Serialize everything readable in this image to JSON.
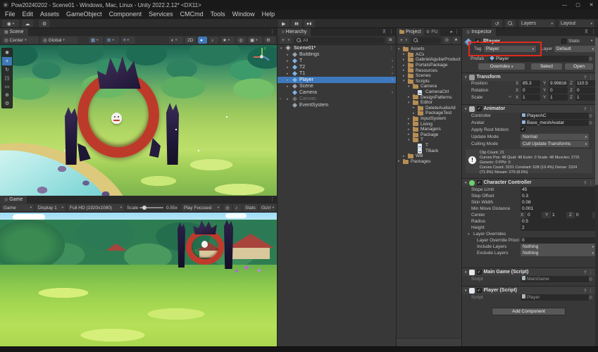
{
  "titlebar": {
    "title": "Pow20240202 - Scene01 - Windows, Mac, Linux - Unity 2022.2.12* <DX11>",
    "minimize": "—",
    "maximize": "▢",
    "close": "✕"
  },
  "menubar": {
    "items": [
      "File",
      "Edit",
      "Assets",
      "GameObject",
      "Component",
      "Services",
      "CMCmd",
      "Tools",
      "Window",
      "Help"
    ]
  },
  "toolbar": {
    "layers": "Layers",
    "layout": "Layout"
  },
  "icons": {
    "dropdown": "▾",
    "menu_dots": "⋮",
    "collapse_open": "▾",
    "collapse_closed": "▸",
    "prefab_arrow": "›",
    "check": "✓",
    "play": "▶",
    "pause": "▮▮",
    "step": "▶▮",
    "account": "◉",
    "cloud": "☁",
    "gear": "⚙",
    "history": "↺",
    "shading": "◐",
    "bulb": "●",
    "audio": "♪",
    "fx": "★",
    "eye": "◎",
    "camera": "▣",
    "grid": "▦",
    "snap": "⊞",
    "increment": "≡",
    "capture": "◎",
    "picker": "◎",
    "help": "?",
    "presets": "☰",
    "link": "∞",
    "warn": "!",
    "overflow": "▸",
    "pin": "⊼",
    "tools": [
      "✱",
      "+",
      "↻",
      "◳",
      "▭",
      "⊕",
      "⚙"
    ]
  },
  "scene_view": {
    "tab": "Scene",
    "pivot": "Center",
    "orientation": "Global",
    "two_d": "2D"
  },
  "game_view": {
    "tab": "Game",
    "mode": "Game",
    "display": "Display 1",
    "resolution": "Full HD (1920x1080)",
    "scale_label": "Scale",
    "scale_value": "0.55x",
    "focus_mode": "Play Focused",
    "stats_label": "Stats",
    "gizmos_label": "Gizmos"
  },
  "hierarchy": {
    "tab": "Hierarchy",
    "create_button": "+",
    "search_text": "All",
    "scene_row": {
      "name": "Scene01*"
    },
    "items": [
      {
        "name": "Buildings",
        "icon": "gameobject",
        "children": true
      },
      {
        "name": "T",
        "icon": "prefab",
        "children": true,
        "prefab_arrow": true
      },
      {
        "name": "T2",
        "icon": "prefab",
        "children": true,
        "prefab_arrow": true
      },
      {
        "name": "T1",
        "icon": "prefab",
        "children": true,
        "prefab_arrow": true
      },
      {
        "name": "Player",
        "icon": "prefab",
        "children": true,
        "prefab_arrow": true,
        "selected": true
      },
      {
        "name": "Scene",
        "icon": "gameobject",
        "children": true
      },
      {
        "name": "Camera",
        "icon": "prefab",
        "prefab_arrow": true
      },
      {
        "name": "Canvas",
        "icon": "gameobject",
        "children": true,
        "dim": true
      },
      {
        "name": "EventSystem",
        "icon": "gameobject"
      }
    ]
  },
  "project": {
    "tab": "Project",
    "tab2": "Piz",
    "create_button": "+",
    "tree": [
      {
        "name": "Assets",
        "depth": 0,
        "type": "folder",
        "state": "open"
      },
      {
        "name": "ACs",
        "depth": 1,
        "type": "folder",
        "state": "closed"
      },
      {
        "name": "GabrielAguilarProductio",
        "depth": 1,
        "type": "folder",
        "state": "closed"
      },
      {
        "name": "PortalsPackage",
        "depth": 1,
        "type": "folder",
        "state": "closed"
      },
      {
        "name": "Resources",
        "depth": 1,
        "type": "folder",
        "state": "closed"
      },
      {
        "name": "Scenes",
        "depth": 1,
        "type": "folder",
        "state": "closed"
      },
      {
        "name": "Scripts",
        "depth": 1,
        "type": "folder",
        "state": "open"
      },
      {
        "name": "Camera",
        "depth": 2,
        "type": "folder",
        "state": "open"
      },
      {
        "name": "CameraCtrl",
        "depth": 3,
        "type": "script"
      },
      {
        "name": "DesignPatterns",
        "depth": 2,
        "type": "folder",
        "state": "closed"
      },
      {
        "name": "Editor",
        "depth": 2,
        "type": "folder",
        "state": "open"
      },
      {
        "name": "DeleteAudioAll",
        "depth": 3,
        "type": "folder",
        "state": "closed"
      },
      {
        "name": "PackageTest",
        "depth": 3,
        "type": "folder",
        "state": "closed"
      },
      {
        "name": "InputSystem",
        "depth": 2,
        "type": "folder",
        "state": "closed"
      },
      {
        "name": "Living",
        "depth": 2,
        "type": "folder",
        "state": "closed"
      },
      {
        "name": "Managers",
        "depth": 2,
        "type": "folder",
        "state": "closed"
      },
      {
        "name": "Package",
        "depth": 2,
        "type": "folder",
        "state": "closed"
      },
      {
        "name": "T",
        "depth": 2,
        "type": "folder",
        "state": "open"
      },
      {
        "name": "T",
        "depth": 3,
        "type": "script"
      },
      {
        "name": "TBack",
        "depth": 3,
        "type": "script"
      },
      {
        "name": "WB",
        "depth": 1,
        "type": "folder",
        "state": "closed"
      },
      {
        "name": "Packages",
        "depth": 0,
        "type": "folder",
        "state": "closed"
      }
    ]
  },
  "axes": [
    "X",
    "Y",
    "Z"
  ],
  "inspector": {
    "tab": "Inspector",
    "header": {
      "name": "Player",
      "static_label": "Static"
    },
    "tag_layer": {
      "tag_label": "Tag",
      "tag": "Player",
      "layer_label": "Layer",
      "layer": "Default"
    },
    "prefab": {
      "label": "Prefab",
      "name": "Player",
      "overrides": "Overrides",
      "select": "Select",
      "open": "Open"
    },
    "transform": {
      "title": "Transform",
      "rows": [
        {
          "label": "Position",
          "x": "85.3",
          "y": "9.99816",
          "z": "110.5"
        },
        {
          "label": "Rotation",
          "x": "0",
          "y": "0",
          "z": "0"
        },
        {
          "label": "Scale",
          "x": "1",
          "y": "1",
          "z": "1",
          "linked": true
        }
      ]
    },
    "animator": {
      "title": "Animator",
      "object_rows": [
        [
          "Controller",
          "PlayerAC"
        ],
        [
          "Avatar",
          "Base_meshAvatar"
        ]
      ],
      "root_motion_label": "Apply Root Motion",
      "update_mode_label": "Update Mode",
      "update_mode": "Normal",
      "culling_label": "Culling Mode",
      "culling": "Cull Update Transforms",
      "info_lines": [
        "Clip Count: 21",
        "Curves Pos: 48 Quat: 48 Euler: 0 Scale: 48 Muscles: 2731 Generic: 0 PPtr: 0",
        "Curves Count: 3231 Constant: 628 (19.4%) Dense: 2324 (71.9%) Stream: 279 (8.6%)"
      ]
    },
    "character_controller": {
      "title": "Character Controller",
      "simple_fields": [
        [
          "Slope Limit",
          "45"
        ],
        [
          "Step Offset",
          "0.3"
        ],
        [
          "Skin Width",
          "0.08"
        ],
        [
          "Min Move Distance",
          "0.001"
        ]
      ],
      "center_label": "Center",
      "center": {
        "x": "0",
        "y": "1",
        "z": "0"
      },
      "after_fields": [
        [
          "Radius",
          "0.5"
        ],
        [
          "Height",
          "2"
        ]
      ],
      "layer_overrides": {
        "title": "Layer Overrides",
        "rows": [
          {
            "label": "Layer Override Priori",
            "value": "0",
            "kind": "field"
          },
          {
            "label": "Include Layers",
            "value": "Nothing",
            "kind": "dropdown"
          },
          {
            "label": "Exclude Layers",
            "value": "Nothing",
            "kind": "dropdown"
          }
        ]
      }
    },
    "scripts": [
      {
        "title": "Main Game (Script)",
        "field_label": "Script",
        "value": "MainGame"
      },
      {
        "title": "Player (Script)",
        "field_label": "Script",
        "value": "Player"
      }
    ],
    "add_component": "Add Component"
  },
  "annotation": {
    "color": "#e02a1e"
  }
}
